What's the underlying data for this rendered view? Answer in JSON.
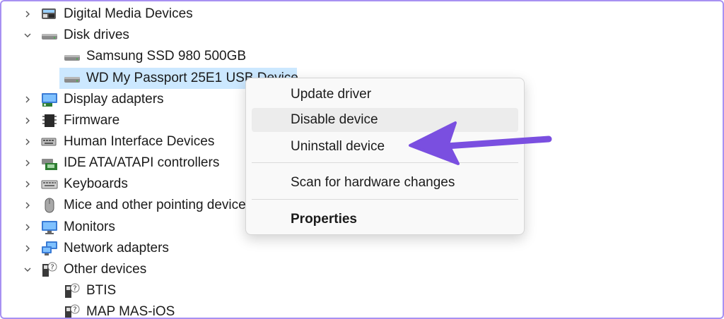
{
  "tree": {
    "rows": [
      {
        "label": "Digital Media Devices",
        "expanded": false,
        "icon": "media-device-icon"
      },
      {
        "label": "Disk drives",
        "expanded": true,
        "icon": "disk-drive-icon"
      },
      {
        "label": "Samsung SSD 980 500GB",
        "child": true,
        "icon": "disk-drive-icon"
      },
      {
        "label": "WD My Passport 25E1 USB Device",
        "child": true,
        "selected": true,
        "icon": "disk-drive-icon"
      },
      {
        "label": "Display adapters",
        "expanded": false,
        "icon": "display-adapter-icon"
      },
      {
        "label": "Firmware",
        "expanded": false,
        "icon": "firmware-icon"
      },
      {
        "label": "Human Interface Devices",
        "expanded": false,
        "icon": "hid-icon"
      },
      {
        "label": "IDE ATA/ATAPI controllers",
        "expanded": false,
        "icon": "ide-controller-icon"
      },
      {
        "label": "Keyboards",
        "expanded": false,
        "icon": "keyboard-icon"
      },
      {
        "label": "Mice and other pointing devices",
        "expanded": false,
        "icon": "mouse-icon"
      },
      {
        "label": "Monitors",
        "expanded": false,
        "icon": "monitor-icon"
      },
      {
        "label": "Network adapters",
        "expanded": false,
        "icon": "network-adapter-icon"
      },
      {
        "label": "Other devices",
        "expanded": true,
        "icon": "unknown-device-icon"
      },
      {
        "label": "BTIS",
        "child": true,
        "icon": "unknown-device-icon"
      },
      {
        "label": "MAP MAS-iOS",
        "child": true,
        "icon": "unknown-device-icon"
      }
    ]
  },
  "context_menu": {
    "update_driver": "Update driver",
    "disable_device": "Disable device",
    "uninstall_device": "Uninstall device",
    "scan": "Scan for hardware changes",
    "properties": "Properties"
  },
  "colors": {
    "frame_border": "#a891f2",
    "selection": "#cce8ff",
    "arrow": "#7a4fe0"
  }
}
